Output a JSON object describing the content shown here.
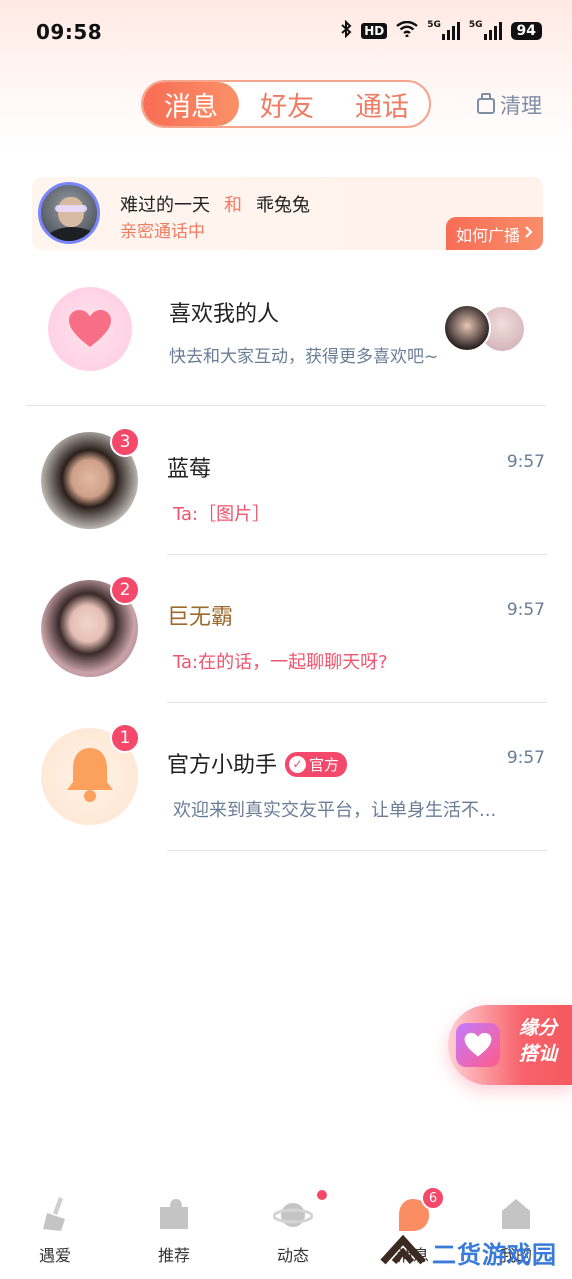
{
  "status_bar": {
    "time": "09:58",
    "hd": "HD",
    "net1": "5G",
    "net2": "5G",
    "battery": "94"
  },
  "tabs": {
    "items": [
      {
        "label": "消息",
        "active": true
      },
      {
        "label": "好友",
        "active": false
      },
      {
        "label": "通话",
        "active": false
      }
    ],
    "clean_label": "清理"
  },
  "banner": {
    "user1": "难过的一天",
    "and": "和",
    "user2": "乖兔兔",
    "status": "亲密通话中",
    "button_label": "如何广播"
  },
  "likes": {
    "title": "喜欢我的人",
    "subtitle": "快去和大家互动，获得更多喜欢吧~"
  },
  "conversations": [
    {
      "name": "蓝莓",
      "time": "9:57",
      "message": "Ta:［图片］",
      "unread": "3"
    },
    {
      "name": "巨无霸",
      "time": "9:57",
      "message": "Ta:在的话，一起聊聊天呀?",
      "unread": "2"
    },
    {
      "name": "官方小助手",
      "badge": "官方",
      "time": "9:57",
      "message": "欢迎来到真实交友平台，让单身生活不...",
      "unread": "1"
    }
  ],
  "fate_button": {
    "text": "缘分搭讪"
  },
  "bottom_nav": {
    "items": [
      {
        "label": "遇爱"
      },
      {
        "label": "推荐"
      },
      {
        "label": "动态"
      },
      {
        "label": "消息",
        "count": "6"
      },
      {
        "label": "我的"
      }
    ]
  },
  "watermark": "二货游戏园",
  "colors": {
    "accent": "#f86d55",
    "badge": "#f4496b",
    "muted": "#6a7d96"
  }
}
